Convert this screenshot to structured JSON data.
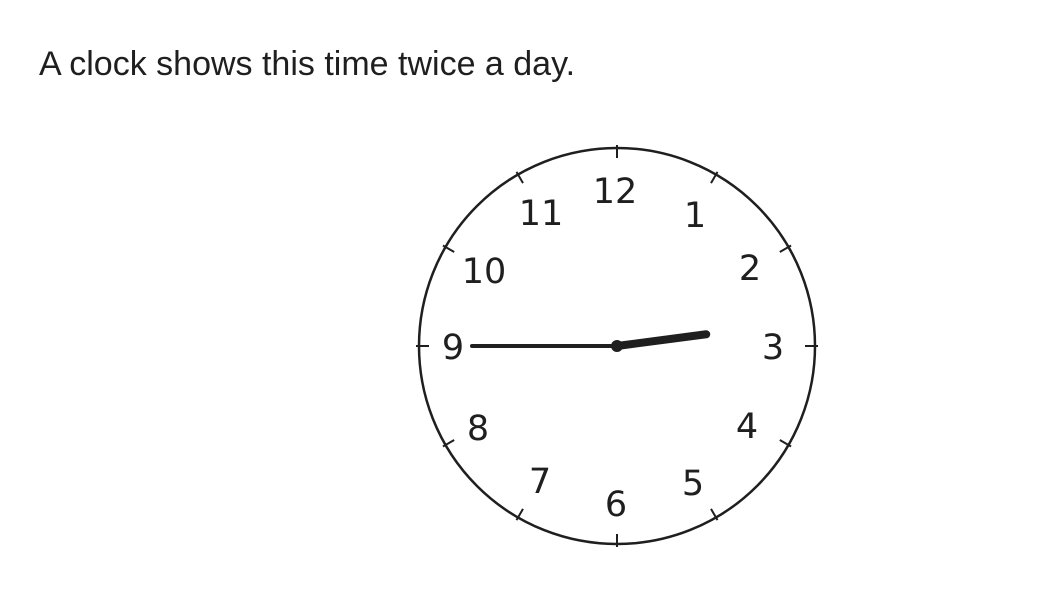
{
  "question": {
    "text": "A clock shows this time twice a day."
  },
  "clock": {
    "numerals": [
      "12",
      "1",
      "2",
      "3",
      "4",
      "5",
      "6",
      "7",
      "8",
      "9",
      "10",
      "11"
    ],
    "time": {
      "hour": 2,
      "minute": 45
    },
    "colors": {
      "face": "#ffffff",
      "ink": "#1f1f1f"
    }
  }
}
